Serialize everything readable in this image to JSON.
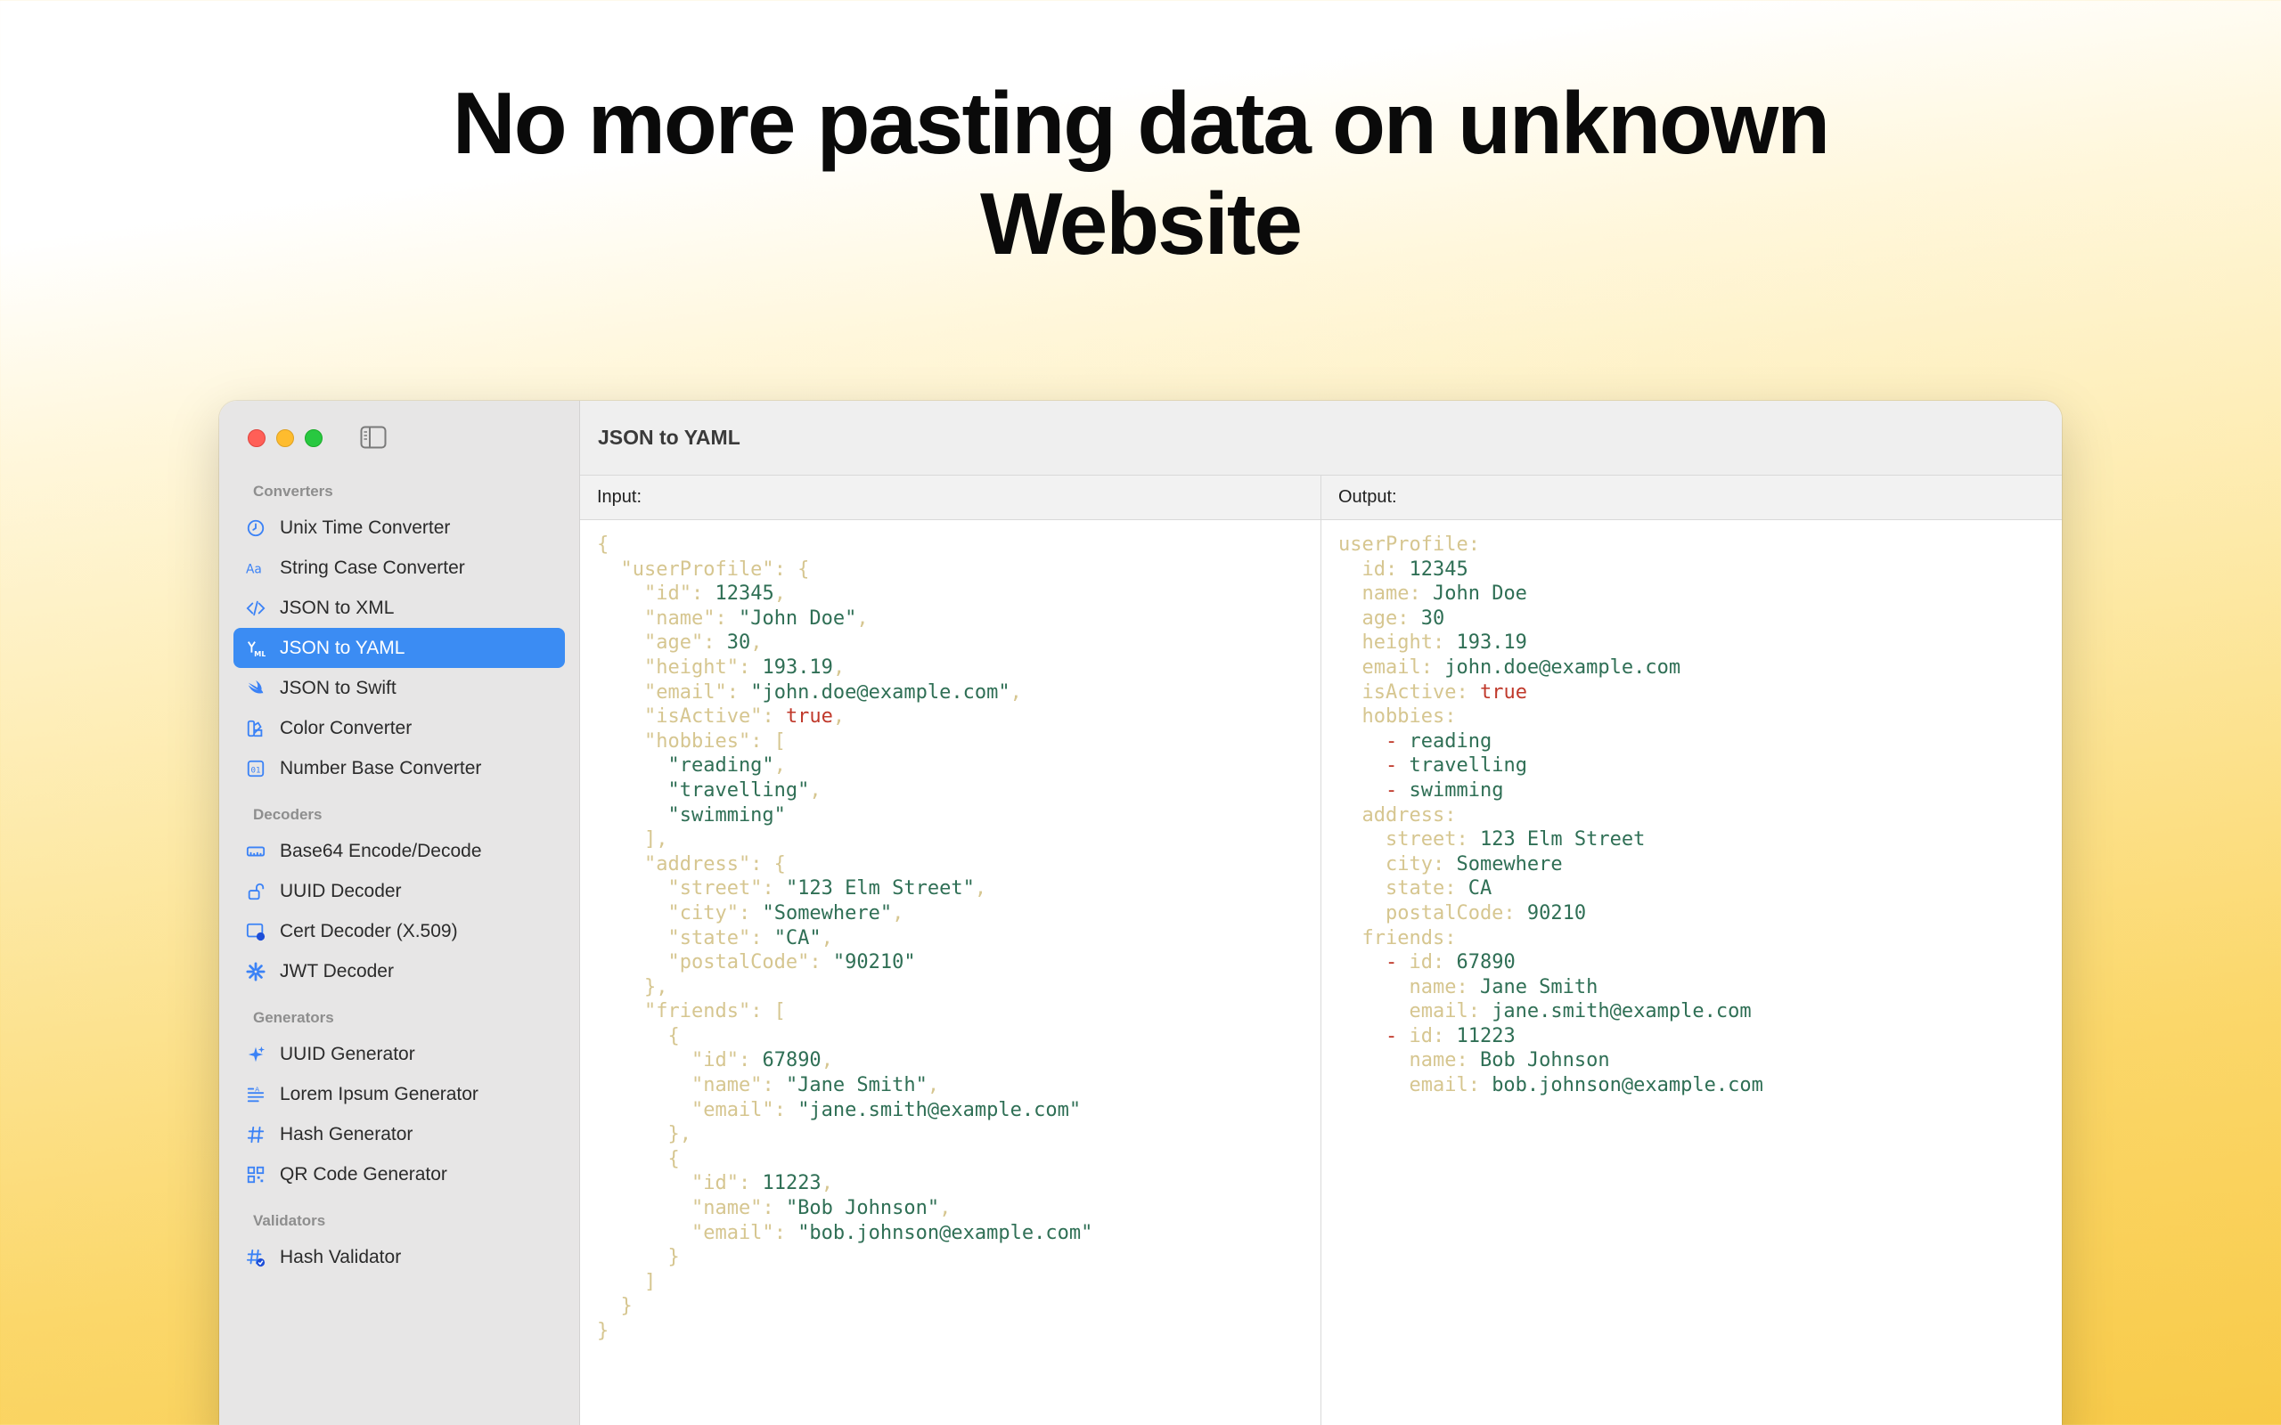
{
  "headline": {
    "line1": "No more pasting data on unknown",
    "line2": "Website"
  },
  "window": {
    "title": "JSON to YAML"
  },
  "sidebar": {
    "sections": [
      {
        "title": "Converters",
        "items": [
          {
            "label": "Unix Time Converter",
            "icon": "clock-icon"
          },
          {
            "label": "String Case Converter",
            "icon": "text-case-icon"
          },
          {
            "label": "JSON to XML",
            "icon": "code-brackets-icon"
          },
          {
            "label": "JSON to YAML",
            "icon": "yaml-icon",
            "active": true
          },
          {
            "label": "JSON to Swift",
            "icon": "swift-icon"
          },
          {
            "label": "Color Converter",
            "icon": "swatch-icon"
          },
          {
            "label": "Number Base Converter",
            "icon": "number-base-icon"
          }
        ]
      },
      {
        "title": "Decoders",
        "items": [
          {
            "label": "Base64 Encode/Decode",
            "icon": "ruler-icon"
          },
          {
            "label": "UUID Decoder",
            "icon": "lock-open-icon"
          },
          {
            "label": "Cert Decoder (X.509)",
            "icon": "certificate-icon"
          },
          {
            "label": "JWT Decoder",
            "icon": "jwt-icon"
          }
        ]
      },
      {
        "title": "Generators",
        "items": [
          {
            "label": "UUID Generator",
            "icon": "sparkles-icon"
          },
          {
            "label": "Lorem Ipsum Generator",
            "icon": "text-lines-icon"
          },
          {
            "label": "Hash Generator",
            "icon": "hash-icon"
          },
          {
            "label": "QR Code Generator",
            "icon": "qr-code-icon"
          }
        ]
      },
      {
        "title": "Validators",
        "items": [
          {
            "label": "Hash Validator",
            "icon": "hash-check-icon"
          }
        ]
      }
    ]
  },
  "input": {
    "header": "Input:",
    "lines": [
      [
        [
          "p",
          "{"
        ]
      ],
      [
        [
          "k",
          "  \"userProfile\""
        ],
        [
          "p",
          ": {"
        ]
      ],
      [
        [
          "k",
          "    \"id\""
        ],
        [
          "p",
          ": "
        ],
        [
          "n",
          "12345"
        ],
        [
          "p",
          ","
        ]
      ],
      [
        [
          "k",
          "    \"name\""
        ],
        [
          "p",
          ": "
        ],
        [
          "s",
          "\"John Doe\""
        ],
        [
          "p",
          ","
        ]
      ],
      [
        [
          "k",
          "    \"age\""
        ],
        [
          "p",
          ": "
        ],
        [
          "n",
          "30"
        ],
        [
          "p",
          ","
        ]
      ],
      [
        [
          "k",
          "    \"height\""
        ],
        [
          "p",
          ": "
        ],
        [
          "n",
          "193.19"
        ],
        [
          "p",
          ","
        ]
      ],
      [
        [
          "k",
          "    \"email\""
        ],
        [
          "p",
          ": "
        ],
        [
          "s",
          "\"john.doe@example.com\""
        ],
        [
          "p",
          ","
        ]
      ],
      [
        [
          "k",
          "    \"isActive\""
        ],
        [
          "p",
          ": "
        ],
        [
          "b",
          "true"
        ],
        [
          "p",
          ","
        ]
      ],
      [
        [
          "k",
          "    \"hobbies\""
        ],
        [
          "p",
          ": ["
        ]
      ],
      [
        [
          "s",
          "      \"reading\""
        ],
        [
          "p",
          ","
        ]
      ],
      [
        [
          "s",
          "      \"travelling\""
        ],
        [
          "p",
          ","
        ]
      ],
      [
        [
          "s",
          "      \"swimming\""
        ]
      ],
      [
        [
          "p",
          "    ],"
        ]
      ],
      [
        [
          "k",
          "    \"address\""
        ],
        [
          "p",
          ": {"
        ]
      ],
      [
        [
          "k",
          "      \"street\""
        ],
        [
          "p",
          ": "
        ],
        [
          "s",
          "\"123 Elm Street\""
        ],
        [
          "p",
          ","
        ]
      ],
      [
        [
          "k",
          "      \"city\""
        ],
        [
          "p",
          ": "
        ],
        [
          "s",
          "\"Somewhere\""
        ],
        [
          "p",
          ","
        ]
      ],
      [
        [
          "k",
          "      \"state\""
        ],
        [
          "p",
          ": "
        ],
        [
          "s",
          "\"CA\""
        ],
        [
          "p",
          ","
        ]
      ],
      [
        [
          "k",
          "      \"postalCode\""
        ],
        [
          "p",
          ": "
        ],
        [
          "s",
          "\"90210\""
        ]
      ],
      [
        [
          "p",
          "    },"
        ]
      ],
      [
        [
          "k",
          "    \"friends\""
        ],
        [
          "p",
          ": ["
        ]
      ],
      [
        [
          "p",
          "      {"
        ]
      ],
      [
        [
          "k",
          "        \"id\""
        ],
        [
          "p",
          ": "
        ],
        [
          "n",
          "67890"
        ],
        [
          "p",
          ","
        ]
      ],
      [
        [
          "k",
          "        \"name\""
        ],
        [
          "p",
          ": "
        ],
        [
          "s",
          "\"Jane Smith\""
        ],
        [
          "p",
          ","
        ]
      ],
      [
        [
          "k",
          "        \"email\""
        ],
        [
          "p",
          ": "
        ],
        [
          "s",
          "\"jane.smith@example.com\""
        ]
      ],
      [
        [
          "p",
          "      },"
        ]
      ],
      [
        [
          "p",
          "      {"
        ]
      ],
      [
        [
          "k",
          "        \"id\""
        ],
        [
          "p",
          ": "
        ],
        [
          "n",
          "11223"
        ],
        [
          "p",
          ","
        ]
      ],
      [
        [
          "k",
          "        \"name\""
        ],
        [
          "p",
          ": "
        ],
        [
          "s",
          "\"Bob Johnson\""
        ],
        [
          "p",
          ","
        ]
      ],
      [
        [
          "k",
          "        \"email\""
        ],
        [
          "p",
          ": "
        ],
        [
          "s",
          "\"bob.johnson@example.com\""
        ]
      ],
      [
        [
          "p",
          "      }"
        ]
      ],
      [
        [
          "p",
          "    ]"
        ]
      ],
      [
        [
          "p",
          "  }"
        ]
      ],
      [
        [
          "p",
          "}"
        ]
      ]
    ]
  },
  "output": {
    "header": "Output:",
    "lines": [
      [
        [
          "y",
          "userProfile:"
        ]
      ],
      [
        [
          "y",
          "  id: "
        ],
        [
          "n",
          "12345"
        ]
      ],
      [
        [
          "y",
          "  name: "
        ],
        [
          "s",
          "John Doe"
        ]
      ],
      [
        [
          "y",
          "  age: "
        ],
        [
          "n",
          "30"
        ]
      ],
      [
        [
          "y",
          "  height: "
        ],
        [
          "n",
          "193.19"
        ]
      ],
      [
        [
          "y",
          "  email: "
        ],
        [
          "s",
          "john.doe@example.com"
        ]
      ],
      [
        [
          "y",
          "  isActive: "
        ],
        [
          "b",
          "true"
        ]
      ],
      [
        [
          "y",
          "  hobbies:"
        ]
      ],
      [
        [
          "d",
          "    - "
        ],
        [
          "s",
          "reading"
        ]
      ],
      [
        [
          "d",
          "    - "
        ],
        [
          "s",
          "travelling"
        ]
      ],
      [
        [
          "d",
          "    - "
        ],
        [
          "s",
          "swimming"
        ]
      ],
      [
        [
          "y",
          "  address:"
        ]
      ],
      [
        [
          "y",
          "    street: "
        ],
        [
          "s",
          "123 Elm Street"
        ]
      ],
      [
        [
          "y",
          "    city: "
        ],
        [
          "s",
          "Somewhere"
        ]
      ],
      [
        [
          "y",
          "    state: "
        ],
        [
          "s",
          "CA"
        ]
      ],
      [
        [
          "y",
          "    postalCode: "
        ],
        [
          "n",
          "90210"
        ]
      ],
      [
        [
          "y",
          "  friends:"
        ]
      ],
      [
        [
          "d",
          "    - "
        ],
        [
          "y",
          "id: "
        ],
        [
          "n",
          "67890"
        ]
      ],
      [
        [
          "y",
          "      name: "
        ],
        [
          "s",
          "Jane Smith"
        ]
      ],
      [
        [
          "y",
          "      email: "
        ],
        [
          "s",
          "jane.smith@example.com"
        ]
      ],
      [
        [
          "d",
          "    - "
        ],
        [
          "y",
          "id: "
        ],
        [
          "n",
          "11223"
        ]
      ],
      [
        [
          "y",
          "      name: "
        ],
        [
          "s",
          "Bob Johnson"
        ]
      ],
      [
        [
          "y",
          "      email: "
        ],
        [
          "s",
          "bob.johnson@example.com"
        ]
      ]
    ]
  }
}
